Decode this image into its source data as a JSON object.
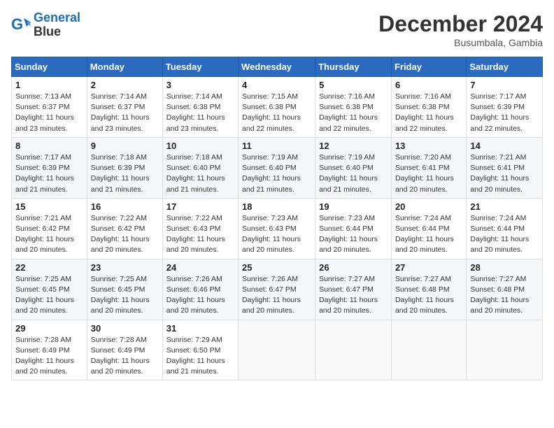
{
  "header": {
    "logo_line1": "General",
    "logo_line2": "Blue",
    "month_year": "December 2024",
    "location": "Busumbala, Gambia"
  },
  "weekdays": [
    "Sunday",
    "Monday",
    "Tuesday",
    "Wednesday",
    "Thursday",
    "Friday",
    "Saturday"
  ],
  "weeks": [
    [
      {
        "day": "1",
        "info": "Sunrise: 7:13 AM\nSunset: 6:37 PM\nDaylight: 11 hours and 23 minutes."
      },
      {
        "day": "2",
        "info": "Sunrise: 7:14 AM\nSunset: 6:37 PM\nDaylight: 11 hours and 23 minutes."
      },
      {
        "day": "3",
        "info": "Sunrise: 7:14 AM\nSunset: 6:38 PM\nDaylight: 11 hours and 23 minutes."
      },
      {
        "day": "4",
        "info": "Sunrise: 7:15 AM\nSunset: 6:38 PM\nDaylight: 11 hours and 22 minutes."
      },
      {
        "day": "5",
        "info": "Sunrise: 7:16 AM\nSunset: 6:38 PM\nDaylight: 11 hours and 22 minutes."
      },
      {
        "day": "6",
        "info": "Sunrise: 7:16 AM\nSunset: 6:38 PM\nDaylight: 11 hours and 22 minutes."
      },
      {
        "day": "7",
        "info": "Sunrise: 7:17 AM\nSunset: 6:39 PM\nDaylight: 11 hours and 22 minutes."
      }
    ],
    [
      {
        "day": "8",
        "info": "Sunrise: 7:17 AM\nSunset: 6:39 PM\nDaylight: 11 hours and 21 minutes."
      },
      {
        "day": "9",
        "info": "Sunrise: 7:18 AM\nSunset: 6:39 PM\nDaylight: 11 hours and 21 minutes."
      },
      {
        "day": "10",
        "info": "Sunrise: 7:18 AM\nSunset: 6:40 PM\nDaylight: 11 hours and 21 minutes."
      },
      {
        "day": "11",
        "info": "Sunrise: 7:19 AM\nSunset: 6:40 PM\nDaylight: 11 hours and 21 minutes."
      },
      {
        "day": "12",
        "info": "Sunrise: 7:19 AM\nSunset: 6:40 PM\nDaylight: 11 hours and 21 minutes."
      },
      {
        "day": "13",
        "info": "Sunrise: 7:20 AM\nSunset: 6:41 PM\nDaylight: 11 hours and 20 minutes."
      },
      {
        "day": "14",
        "info": "Sunrise: 7:21 AM\nSunset: 6:41 PM\nDaylight: 11 hours and 20 minutes."
      }
    ],
    [
      {
        "day": "15",
        "info": "Sunrise: 7:21 AM\nSunset: 6:42 PM\nDaylight: 11 hours and 20 minutes."
      },
      {
        "day": "16",
        "info": "Sunrise: 7:22 AM\nSunset: 6:42 PM\nDaylight: 11 hours and 20 minutes."
      },
      {
        "day": "17",
        "info": "Sunrise: 7:22 AM\nSunset: 6:43 PM\nDaylight: 11 hours and 20 minutes."
      },
      {
        "day": "18",
        "info": "Sunrise: 7:23 AM\nSunset: 6:43 PM\nDaylight: 11 hours and 20 minutes."
      },
      {
        "day": "19",
        "info": "Sunrise: 7:23 AM\nSunset: 6:44 PM\nDaylight: 11 hours and 20 minutes."
      },
      {
        "day": "20",
        "info": "Sunrise: 7:24 AM\nSunset: 6:44 PM\nDaylight: 11 hours and 20 minutes."
      },
      {
        "day": "21",
        "info": "Sunrise: 7:24 AM\nSunset: 6:44 PM\nDaylight: 11 hours and 20 minutes."
      }
    ],
    [
      {
        "day": "22",
        "info": "Sunrise: 7:25 AM\nSunset: 6:45 PM\nDaylight: 11 hours and 20 minutes."
      },
      {
        "day": "23",
        "info": "Sunrise: 7:25 AM\nSunset: 6:45 PM\nDaylight: 11 hours and 20 minutes."
      },
      {
        "day": "24",
        "info": "Sunrise: 7:26 AM\nSunset: 6:46 PM\nDaylight: 11 hours and 20 minutes."
      },
      {
        "day": "25",
        "info": "Sunrise: 7:26 AM\nSunset: 6:47 PM\nDaylight: 11 hours and 20 minutes."
      },
      {
        "day": "26",
        "info": "Sunrise: 7:27 AM\nSunset: 6:47 PM\nDaylight: 11 hours and 20 minutes."
      },
      {
        "day": "27",
        "info": "Sunrise: 7:27 AM\nSunset: 6:48 PM\nDaylight: 11 hours and 20 minutes."
      },
      {
        "day": "28",
        "info": "Sunrise: 7:27 AM\nSunset: 6:48 PM\nDaylight: 11 hours and 20 minutes."
      }
    ],
    [
      {
        "day": "29",
        "info": "Sunrise: 7:28 AM\nSunset: 6:49 PM\nDaylight: 11 hours and 20 minutes."
      },
      {
        "day": "30",
        "info": "Sunrise: 7:28 AM\nSunset: 6:49 PM\nDaylight: 11 hours and 20 minutes."
      },
      {
        "day": "31",
        "info": "Sunrise: 7:29 AM\nSunset: 6:50 PM\nDaylight: 11 hours and 21 minutes."
      },
      null,
      null,
      null,
      null
    ]
  ]
}
